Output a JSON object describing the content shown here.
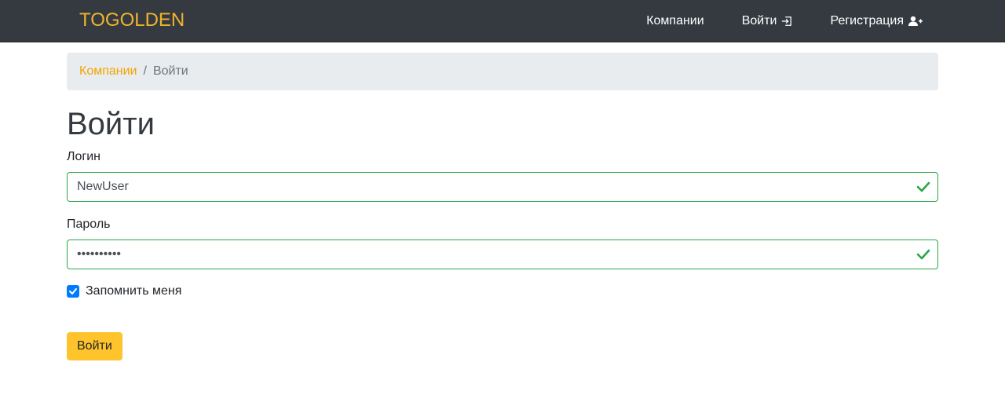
{
  "navbar": {
    "brand": "TOGOLDEN",
    "links": [
      {
        "label": "Компании"
      },
      {
        "label": "Войти",
        "icon": "sign-in-icon"
      },
      {
        "label": "Регистрация",
        "icon": "user-plus-icon"
      }
    ]
  },
  "breadcrumb": {
    "parent": "Компании",
    "separator": "/",
    "current": "Войти"
  },
  "page": {
    "title": "Войти"
  },
  "form": {
    "login_label": "Логин",
    "login_value": "NewUser",
    "password_label": "Пароль",
    "password_value": "••••••••••",
    "remember_label": "Запомнить меня",
    "remember_checked": true,
    "submit_label": "Войти"
  },
  "colors": {
    "navbar_bg": "#343a40",
    "brand": "#f0b42c",
    "valid": "#28a745",
    "checkbox": "#007bff",
    "button": "#ffc42c"
  }
}
